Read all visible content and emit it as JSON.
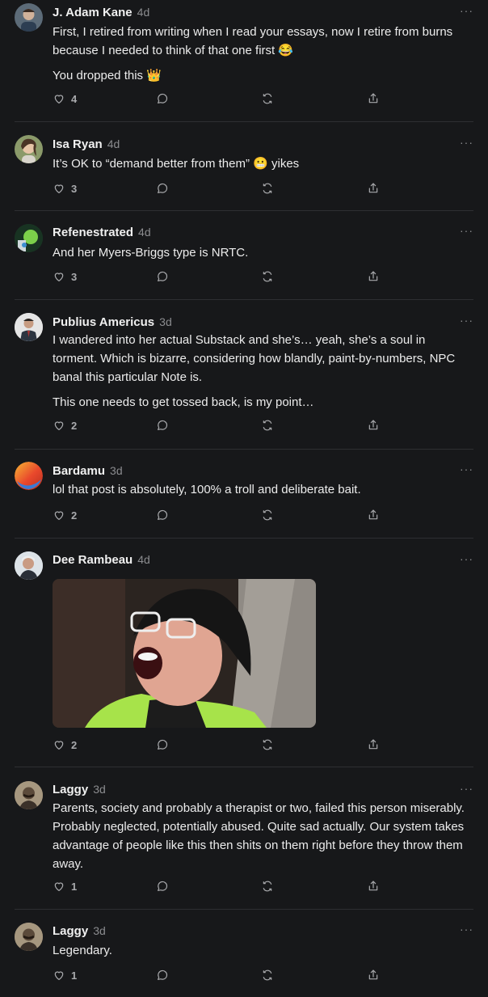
{
  "comments": [
    {
      "author": "J. Adam Kane",
      "time": "4d",
      "more": "···",
      "paragraphs": [
        "First, I retired from writing when I read your essays, now I retire from burns because I needed to think of that one first 😂",
        "You dropped this 👑"
      ],
      "likes": "4"
    },
    {
      "author": "Isa Ryan",
      "time": "4d",
      "more": "···",
      "paragraphs": [
        "It’s OK to “demand better from them” 😬 yikes"
      ],
      "likes": "3"
    },
    {
      "author": "Refenestrated",
      "time": "4d",
      "more": "···",
      "paragraphs": [
        "And her Myers-Briggs type is NRTC."
      ],
      "likes": "3"
    },
    {
      "author": "Publius Americus",
      "time": "3d",
      "more": "···",
      "paragraphs": [
        "I wandered into her actual Substack and she’s… yeah, she’s a soul in torment. Which is bizarre, considering how blandly, paint-by-numbers, NPC banal this particular Note is.",
        "This one needs to get tossed back, is my point…"
      ],
      "likes": "2"
    },
    {
      "author": "Bardamu",
      "time": "3d",
      "more": "···",
      "paragraphs": [
        "lol that post is absolutely, 100% a troll and deliberate bait."
      ],
      "likes": "2"
    },
    {
      "author": "Dee Rambeau",
      "time": "4d",
      "more": "···",
      "paragraphs": [],
      "likes": "2"
    },
    {
      "author": "Laggy",
      "time": "3d",
      "more": "···",
      "paragraphs": [
        "Parents, society and probably a therapist or two, failed this person miserably. Probably neglected, potentially abused. Quite sad actually. Our system takes advantage of people like this then shits on them right before they throw them away."
      ],
      "likes": "1"
    },
    {
      "author": "Laggy",
      "time": "3d",
      "more": "···",
      "paragraphs": [
        "Legendary."
      ],
      "likes": "1"
    }
  ],
  "icons": {
    "like": "heart-icon",
    "reply": "comment-bubble-icon",
    "restack": "restack-icon",
    "share": "share-icon"
  },
  "colors": {
    "background": "#17181a",
    "text": "#e9e9ea",
    "muted": "#8b8c8f"
  }
}
